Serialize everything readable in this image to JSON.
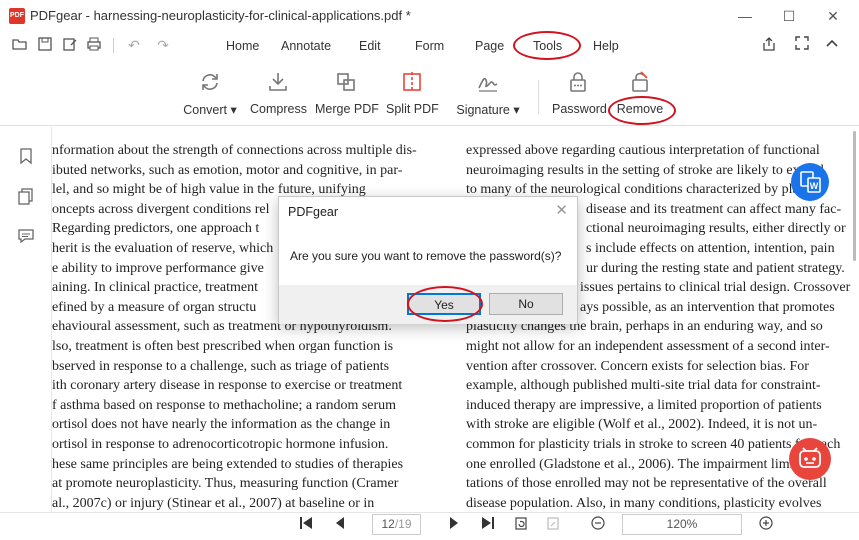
{
  "window": {
    "app_logo_text": "PDF",
    "title": "PDFgear - harnessing-neuroplasticity-for-clinical-applications.pdf *",
    "controls": [
      "minimize-icon",
      "maximize-icon",
      "close-icon"
    ]
  },
  "menu": {
    "items": [
      "Home",
      "Annotate",
      "Edit",
      "Form",
      "Page",
      "Tools",
      "Help"
    ],
    "active": "Tools"
  },
  "toolbar": {
    "convert": "Convert",
    "compress": "Compress",
    "merge": "Merge PDF",
    "split": "Split PDF",
    "signature": "Signature",
    "password": "Password",
    "remove": "Remove"
  },
  "document": {
    "left_lines": [
      "nformation about the strength of connections across multiple dis-",
      "ibuted networks, such as emotion, motor and cognitive, in par-",
      "lel, and so might be of high value in the future, unifying",
      "oncepts across divergent conditions rel",
      " Regarding predictors, one approach t",
      "herit is the evaluation of reserve, which",
      "e ability to improve performance give",
      "aining. In clinical practice, treatment",
      "efined by a measure of organ structu",
      "ehavioural assessment, such as treatment or hypothyroidism.",
      "lso, treatment is often best prescribed when organ function is",
      "bserved in response to a challenge, such as triage of patients",
      "ith coronary artery disease in response to exercise or treatment",
      "f asthma based on response to methacholine; a random serum",
      "ortisol does not have nearly the information as the change in",
      "ortisol in response to adrenocorticotropic hormone infusion.",
      "hese same principles are being extended to studies of therapies",
      "at promote neuroplasticity. Thus, measuring function (Cramer",
      " al., 2007c) or injury (Stinear et al., 2007) at baseline or in"
    ],
    "right_lines": [
      "expressed above regarding cautious interpretation of functional",
      "neuroimaging results in the setting of stroke are likely to extend",
      "to many of the neurological conditions characterized by plas-",
      "disease and its treatment can affect many fac-",
      "ctional neuroimaging results, either directly or",
      "s include effects on attention, intention, pain",
      "ur during the resting state and patient strategy.",
      "issues pertains to clinical trial design. Crossover",
      "ays possible, as an intervention that promotes",
      "plasticity changes the brain, perhaps in an enduring way, and so",
      "might not allow for an independent assessment of a second inter-",
      "vention after crossover. Concern exists for selection bias. For",
      "example, although published multi-site trial data for constraint-",
      "induced therapy are impressive, a limited proportion of patients",
      "with stroke are eligible (Wolf et al., 2002). Indeed, it is not un-",
      "common for plasticity trials in stroke to screen 40 patients for each",
      "one enrolled (Gladstone et al., 2006). The impairment limi-",
      "tations of those enrolled may not be representative of the overall",
      "disease population. Also, in many conditions, plasticity evolves"
    ]
  },
  "pagination": {
    "current": "12",
    "total": "/19",
    "zoom": "120%"
  },
  "dialog": {
    "title": "PDFgear",
    "message": "Are you sure you want to remove the password(s)?",
    "yes": "Yes",
    "no": "No"
  },
  "colors": {
    "accent_blue": "#1a73e8",
    "annotation_red": "#d0141f",
    "float_red": "#e8463c",
    "app_red": "#e0352b"
  }
}
